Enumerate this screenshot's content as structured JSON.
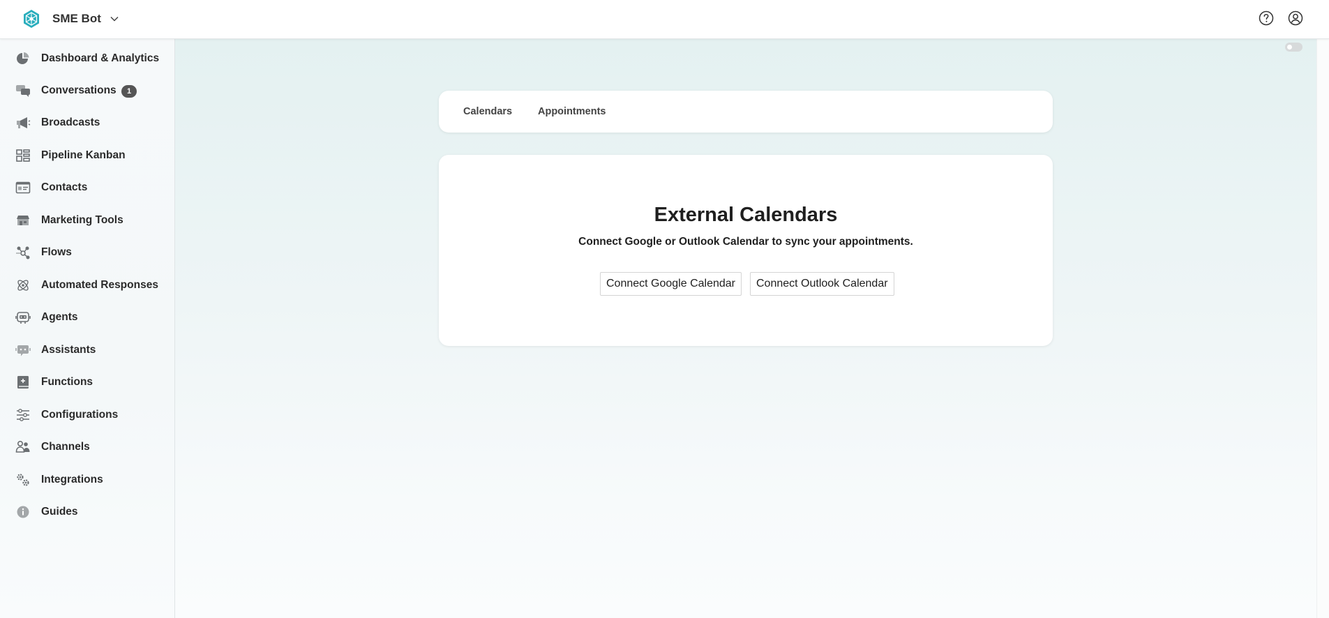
{
  "header": {
    "brand": "SME Bot",
    "logo_icon": "brand-logo-icon",
    "dropdown_icon": "chevron-down-icon",
    "help_icon": "help-circle-icon",
    "account_icon": "user-account-icon"
  },
  "sidebar": {
    "items": [
      {
        "label": "Dashboard & Analytics",
        "icon": "pie-chart-icon"
      },
      {
        "label": "Conversations",
        "icon": "chat-bubbles-icon",
        "badge": "1"
      },
      {
        "label": "Broadcasts",
        "icon": "megaphone-icon"
      },
      {
        "label": "Pipeline Kanban",
        "icon": "kanban-board-icon"
      },
      {
        "label": "Contacts",
        "icon": "contact-card-icon"
      },
      {
        "label": "Marketing Tools",
        "icon": "storefront-icon"
      },
      {
        "label": "Flows",
        "icon": "flow-nodes-icon"
      },
      {
        "label": "Automated Responses",
        "icon": "atom-icon"
      },
      {
        "label": "Agents",
        "icon": "robot-agent-icon"
      },
      {
        "label": "Assistants",
        "icon": "assistant-icon"
      },
      {
        "label": "Functions",
        "icon": "function-book-icon"
      },
      {
        "label": "Configurations",
        "icon": "sliders-icon"
      },
      {
        "label": "Channels",
        "icon": "users-channels-icon"
      },
      {
        "label": "Integrations",
        "icon": "gears-icon"
      },
      {
        "label": "Guides",
        "icon": "info-icon"
      }
    ]
  },
  "main": {
    "tabs": [
      {
        "label": "Calendars"
      },
      {
        "label": "Appointments"
      }
    ],
    "card": {
      "title": "External Calendars",
      "subtitle": "Connect Google or Outlook Calendar to sync your appointments.",
      "buttons": {
        "google": "Connect Google Calendar",
        "outlook": "Connect Outlook Calendar"
      }
    },
    "theme_toggle": {
      "state": "off",
      "icon": "toggle-switch-icon"
    }
  },
  "colors": {
    "brand_teal": "#27a9b8",
    "badge_bg": "#555555",
    "main_bg_top": "#e4f1f1",
    "main_bg_bottom": "#fafcfd",
    "icon_gray": "#6b6f72"
  }
}
